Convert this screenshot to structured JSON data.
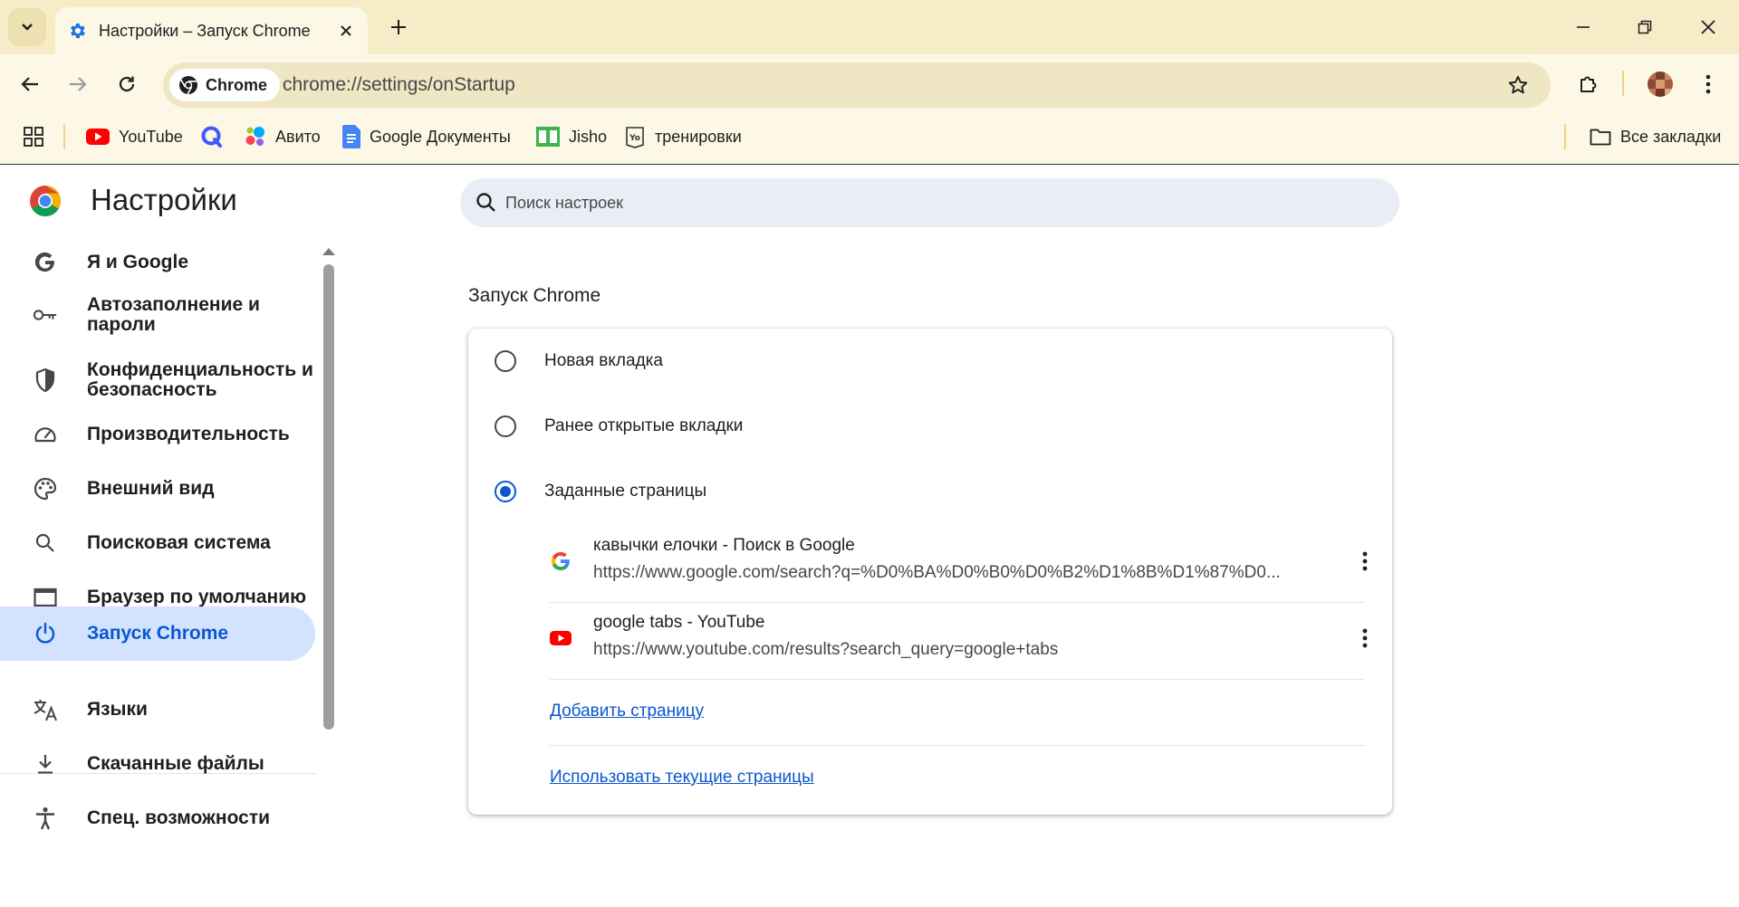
{
  "tab": {
    "title": "Настройки – Запуск Chrome"
  },
  "toolbar": {
    "chip_label": "Chrome",
    "url": "chrome://settings/onStartup"
  },
  "bookmarks": {
    "items": [
      {
        "label": "YouTube",
        "icon": "youtube-icon"
      },
      {
        "label": "",
        "icon": "q-icon"
      },
      {
        "label": "Авито",
        "icon": "avito-icon"
      },
      {
        "label": "Google Документы",
        "icon": "google-docs-icon"
      },
      {
        "label": "Jisho",
        "icon": "jisho-icon"
      },
      {
        "label": "тренировки",
        "icon": "yo-icon"
      }
    ],
    "all_bookmarks": "Все закладки"
  },
  "settings": {
    "title": "Настройки",
    "search_placeholder": "Поиск настроек",
    "nav": [
      {
        "label": "Я и Google",
        "icon": "google-g-icon"
      },
      {
        "label": "Автозаполнение и пароли",
        "icon": "key-icon"
      },
      {
        "label": "Конфиденциальность и безопасность",
        "icon": "shield-icon"
      },
      {
        "label": "Производительность",
        "icon": "speedometer-icon"
      },
      {
        "label": "Внешний вид",
        "icon": "palette-icon"
      },
      {
        "label": "Поисковая система",
        "icon": "search-icon"
      },
      {
        "label": "Браузер по умолчанию",
        "icon": "browser-window-icon"
      },
      {
        "label": "Запуск Chrome",
        "icon": "power-icon",
        "active": true
      },
      {
        "label": "Языки",
        "icon": "translate-icon"
      },
      {
        "label": "Скачанные файлы",
        "icon": "download-icon"
      },
      {
        "label": "Спец. возможности",
        "icon": "accessibility-icon"
      }
    ]
  },
  "startup": {
    "section_title": "Запуск Chrome",
    "options": [
      {
        "label": "Новая вкладка",
        "checked": false
      },
      {
        "label": "Ранее открытые вкладки",
        "checked": false
      },
      {
        "label": "Заданные страницы",
        "checked": true
      }
    ],
    "pages": [
      {
        "title": "кавычки елочки - Поиск в Google",
        "url": "https://www.google.com/search?q=%D0%BA%D0%B0%D0%B2%D1%8B%D1%87%D0...",
        "icon": "google-g-icon"
      },
      {
        "title": "google tabs - YouTube",
        "url": "https://www.youtube.com/results?search_query=google+tabs",
        "icon": "youtube-icon"
      }
    ],
    "add_page": "Добавить страницу",
    "use_current": "Использовать текущие страницы"
  },
  "colors": {
    "accent": "#0b57d0",
    "frame": "#f6ecc7",
    "toolbar": "#fdf7e6",
    "active_nav": "#d3e3fd"
  }
}
